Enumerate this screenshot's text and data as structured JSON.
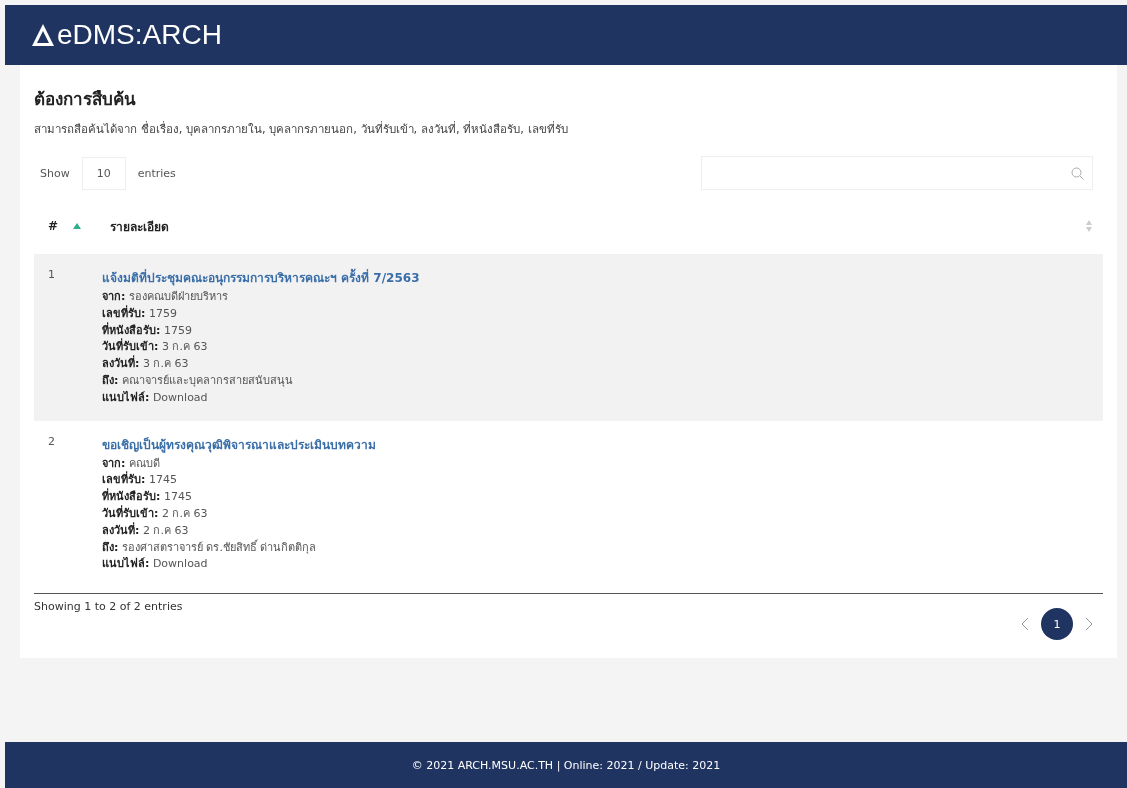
{
  "header": {
    "logo_text": "eDMS:ARCH"
  },
  "title": "ต้องการสืบค้น",
  "description": "สามารถสือค้นได้จาก ชื่อเรื่อง, บุคลากรภายใน, บุคลากรภายนอก, วันที่รับเข้า, ลงวันที่, ที่หนังสือรับ, เลขที่รับ",
  "length_control": {
    "label_before": "Show",
    "value": "10",
    "label_after": "entries"
  },
  "table": {
    "columns": [
      {
        "label": "#",
        "sorted": true
      },
      {
        "label": "รายละเอียด",
        "sorted": false
      }
    ],
    "rows": [
      {
        "number": "1",
        "title": "แจ้งมติที่ประชุมคณะอนุกรรมการบริหารคณะฯ ครั้งที่ 7/2563",
        "lines": [
          "**จาก:** รองคณบดีฝ่ายบริหาร",
          "**เลขที่รับ:** 1759",
          "**ที่หนังสือรับ:** 1759",
          "**วันที่รับเข้า:** 3 ก.ค 63",
          "**ลงวันที่:** 3 ก.ค 63",
          "**ถึง:** คณาจารย์และบุคลากรสายสนับสนุน",
          "**แนบไฟล์:** Download"
        ]
      },
      {
        "number": "2",
        "title": "ขอเชิญเป็นผู้ทรงคุณวุฒิพิจารณาและประเมินบทความ",
        "lines": [
          "**จาก:** คณบดี",
          "**เลขที่รับ:** 1745",
          "**ที่หนังสือรับ:** 1745",
          "**วันที่รับเข้า:** 2 ก.ค 63",
          "**ลงวันที่:** 2 ก.ค 63",
          "**ถึง:** รองศาสตราจารย์ ดร.ชัยสิทธิ์ ด่านกิตติกุล",
          "**แนบไฟล์:** Download"
        ]
      }
    ]
  },
  "info": "Showing 1 to 2 of 2 entries",
  "pagination": {
    "pages": [
      {
        "label": "1",
        "selected": true
      }
    ]
  },
  "footer": "© 2021 ARCH.MSU.AC.TH | Online: 2021 / Update: 2021"
}
